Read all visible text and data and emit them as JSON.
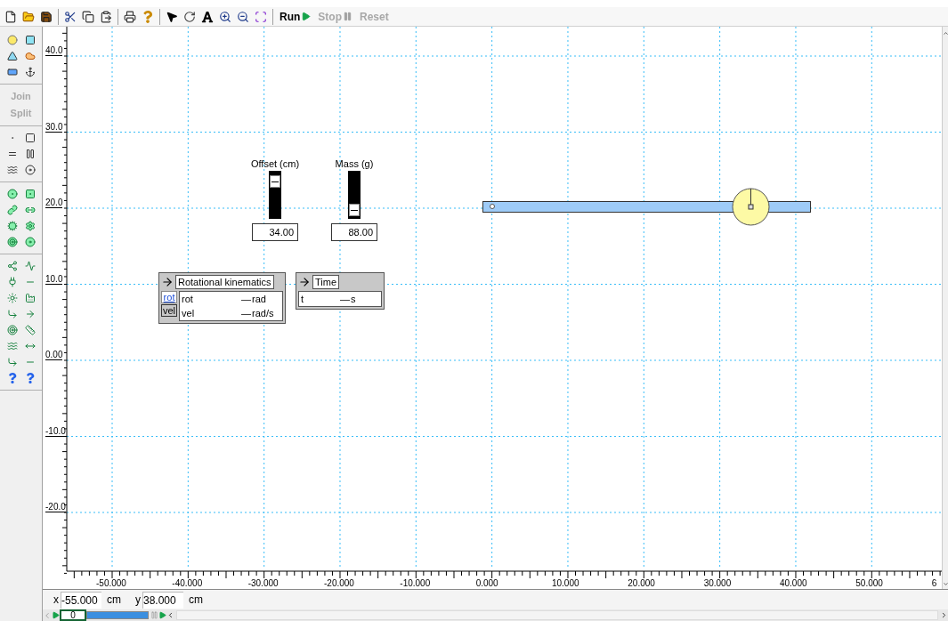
{
  "toolbar": {
    "actions": [
      {
        "label": "Run",
        "disabled": false
      },
      {
        "label": "Stop",
        "disabled": true
      },
      {
        "label": "Reset",
        "disabled": true
      }
    ]
  },
  "palette": {
    "buttons": [
      {
        "label": "Join",
        "disabled": true
      },
      {
        "label": "Split",
        "disabled": true
      }
    ]
  },
  "rulers": {
    "vertical_labels": [
      "40.0",
      "30.0",
      "20.0",
      "10.0",
      "0.00",
      "-10.0",
      "-20.0"
    ],
    "horizontal_labels": [
      "-50.000",
      "-40.000",
      "-30.000",
      "-20.000",
      "-10.000",
      "0.000",
      "10.000",
      "20.000",
      "30.000",
      "40.000",
      "50.000",
      "6"
    ]
  },
  "sliders": [
    {
      "label": "Offset (cm)",
      "level": 0.88,
      "value": "34.00"
    },
    {
      "label": "Mass (g)",
      "level": 0.08,
      "value": "88.00"
    }
  ],
  "meters": [
    {
      "title": "Rotational kinematics",
      "tabs": [
        {
          "label": "rot",
          "selected": true
        },
        {
          "label": "vel",
          "selected": false
        }
      ],
      "rows": [
        {
          "name": "rot",
          "value": "—",
          "unit": "rad"
        },
        {
          "name": "vel",
          "value": "—",
          "unit": "rad/s"
        }
      ]
    },
    {
      "title": "Time",
      "rows": [
        {
          "name": "t",
          "value": "—",
          "unit": "s"
        }
      ]
    }
  ],
  "status_bar": {
    "x_label": "x",
    "x_value": "-55.000",
    "x_unit": "cm",
    "y_label": "y",
    "y_value": "38.000",
    "y_unit": "cm"
  },
  "playback": {
    "frame": "0"
  }
}
